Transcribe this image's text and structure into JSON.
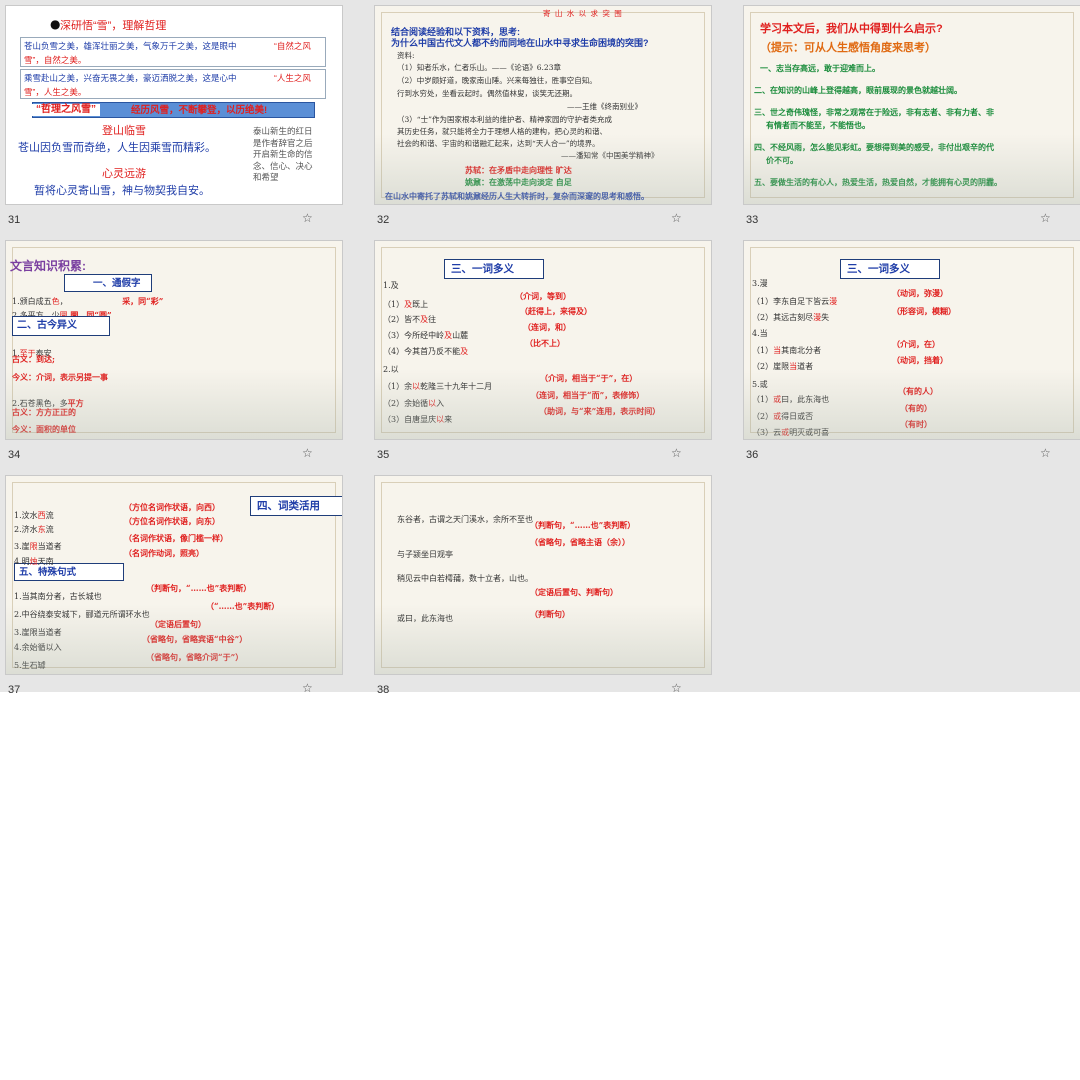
{
  "slides": {
    "s31": {
      "number": "31",
      "title": "深研悟“雪”，理解哲理",
      "box1_a": "苍山负雪之美，雄浑壮丽之美，气象万千之美，这是眼中",
      "box1_b": "“自然之风",
      "box1_c": "雪”，自然之美。",
      "box2_a": "乘雪赴山之美，兴奋无畏之美，豪迈洒脱之美，这是心中",
      "box2_b": "“人生之风",
      "box2_c": "雪”，人生之美。",
      "banner_left": "“哲理之风雪”",
      "banner_right": "经历风雪，不断攀登，以历绝美!",
      "heading1": "登山临雪",
      "line1": "苍山因负雪而奇绝，人生因乘雪而精彩。",
      "heading2": "心灵远游",
      "line2": "暂将心灵寄山雪，神与物契我自安。",
      "side_note": [
        "泰山新生的红日",
        "是作者辞官之后",
        "开启新生命的信",
        "念、信心、决心",
        "和希望"
      ]
    },
    "s32": {
      "number": "32",
      "top": "寄 山 水 以 求 突 围",
      "q1": "结合阅读经验和以下资料，思考:",
      "q2": "为什么中国古代文人都不约而同地在山水中寻求生命困境的突围?",
      "lines": [
        "资料:",
        "（1）知者乐水，仁者乐山。——《论语》6.23章",
        "（2）中岁颇好道，晚家南山陲。兴来每独往，胜事空自知。",
        "行到水穷处，坐看云起时。偶然值林叟，谈笑无还期。",
        "——王维《终南别业》",
        "（3）“士”作为国家根本利益的维护者、精神家园的守护者类充成",
        "其历史任务，就只能将全力于理想人格的建构，把心灵的和谐、",
        "社会的和谐、宇宙的和谐融汇起来，达到“天人合一”的境界。",
        "——潘知常《中国美学精神》"
      ],
      "r1": "苏轼：在矛盾中走向理性 旷达",
      "r2": "姚鼐：在激荡中走向淡定 自足",
      "bottom": "在山水中寄托了苏轼和姚鼐经历人生大转折时，复杂而深邃的思考和感悟。"
    },
    "s33": {
      "number": "33",
      "title": "学习本文后，我们从中得到什么启示?",
      "hint": "（提示：可从人生感悟角度来思考）",
      "items": [
        "一、志当存高远，敢于迎难而上。",
        "二、在知识的山峰上登得越高，眼前展现的景色就越壮阔。",
        "三、世之奇伟瑰怪，非常之观常在于险远，非有志者、非有力者、非",
        "有情者而不能至，不能悟也。",
        "四、不经风雨，怎么能见彩虹。要想得到美的感受，非付出艰辛的代",
        "价不可。",
        "五、要做生活的有心人，热爱生活，热爱自然，才能拥有心灵的阴霾。"
      ]
    },
    "s34": {
      "number": "34",
      "title": "文言知识积累:",
      "sec1": "一、通假字",
      "l1a": "1.颁白成五",
      "l1b": "色",
      "l1c": "，  ",
      "l1d": "采，同“彩”",
      "l2a": "2.多平方，少",
      "l2b": "圜",
      "l2c": "     圜，同“圆”",
      "sec2": "二、古今异义",
      "l3a": "1.",
      "l3b": "至于",
      "l3c": "泰安",
      "l4": "古义：到达;",
      "l5": "今义：介词，表示另提一事",
      "l6a": "2.石苍黑色，多",
      "l6b": "平方",
      "l7": "古义：方方正正的",
      "l8": "今义：面积的单位"
    },
    "s35": {
      "number": "35",
      "sec": "三、一词多义",
      "rows": [
        {
          "pre": "1.及",
          "hl": "",
          "post": "",
          "note": ""
        },
        {
          "pre": "（1）",
          "hl": "及",
          "post": "既上",
          "note": "（介词，等到）"
        },
        {
          "pre": "（2）皆不",
          "hl": "及",
          "post": "往",
          "note": "（赶得上，来得及）"
        },
        {
          "pre": "（3）今所经中岭",
          "hl": "及",
          "post": "山麓",
          "note": "（连词，和）"
        },
        {
          "pre": "（4）今其首乃反不能",
          "hl": "及",
          "post": "",
          "note": "（比不上）"
        },
        {
          "pre": "2.以",
          "hl": "",
          "post": "",
          "note": ""
        },
        {
          "pre": "（1）余",
          "hl": "以",
          "post": "乾隆三十九年十二月",
          "note": "（介词，相当于“于”，在）"
        },
        {
          "pre": "（2）余始循",
          "hl": "以",
          "post": "入",
          "note": "（连词，相当于“而”，表修饰）"
        },
        {
          "pre": "（3）自唐显庆",
          "hl": "以",
          "post": "来",
          "note": "（助词，与“来”连用，表示时间）"
        }
      ]
    },
    "s36": {
      "number": "36",
      "sec": "三、一词多义",
      "rows": [
        {
          "pre": "3.漫",
          "hl": "",
          "post": "",
          "note": ""
        },
        {
          "pre": "（1）李东自足下皆云",
          "hl": "漫",
          "post": "",
          "note": "（动词，弥漫）"
        },
        {
          "pre": "（2）其远古刻尽",
          "hl": "漫",
          "post": "失",
          "note": "（形容词，模糊）"
        },
        {
          "pre": "4.当",
          "hl": "",
          "post": "",
          "note": ""
        },
        {
          "pre": "（1）",
          "hl": "当",
          "post": "其南北分者",
          "note": "（介词，在）"
        },
        {
          "pre": "（2）崖限",
          "hl": "当",
          "post": "道者",
          "note": "（动词，挡着）"
        },
        {
          "pre": "5.或",
          "hl": "",
          "post": "",
          "note": ""
        },
        {
          "pre": "（1）",
          "hl": "或",
          "post": "曰，此东海也",
          "note": "（有的人）"
        },
        {
          "pre": "（2）",
          "hl": "或",
          "post": "得日或否",
          "note": "（有的）"
        },
        {
          "pre": "（3）云",
          "hl": "或",
          "post": "明灭或可喜",
          "note": "（有时）"
        }
      ]
    },
    "s37": {
      "number": "37",
      "sec4": "四、词类活用",
      "sec5": "五、特殊句式",
      "rows": [
        {
          "pre": "1.汶水",
          "hl": "西",
          "post": "流",
          "note": "（方位名词作状语，向西）"
        },
        {
          "pre": "2.济水",
          "hl": "东",
          "post": "流",
          "note": "（方位名词作状语，向东）"
        },
        {
          "pre": "3.崖",
          "hl": "限",
          "post": "当道者",
          "note": "（名词作状语，像门槛一样）"
        },
        {
          "pre": "4.明",
          "hl": "烛",
          "post": "天南",
          "note": "（名词作动词，照亮）"
        },
        {
          "pre": "1.当其南分者，古长城也",
          "hl": "",
          "post": "",
          "note": "（判断句，“……也”表判断）"
        },
        {
          "pre": "2.中谷绕泰安城下，郦道元所谓环水也",
          "hl": "",
          "post": "",
          "note": "（“……也”表判断）"
        },
        {
          "pre": "3.崖限当道者",
          "hl": "",
          "post": "",
          "note": "（定语后置句）"
        },
        {
          "pre": "4.余始循以入",
          "hl": "",
          "post": "",
          "note": "（省略句，省略宾语“中谷”）"
        },
        {
          "pre": "5.生石罅",
          "hl": "",
          "post": "",
          "note": "（省略句，省略介词“于”）"
        }
      ]
    },
    "s38": {
      "number": "38",
      "rows": [
        {
          "text": "东谷者，古谓之天门溪水，余所不至也",
          "note": "（判断句，“……也”表判断）"
        },
        {
          "text": "与子颍坐日观亭",
          "note": "（省略句，省略主语（余））"
        },
        {
          "text": "稍见云中白若樗蒱，数十立者，山也。",
          "note": "（定语后置句、判断句）"
        },
        {
          "text": "或曰，此东海也",
          "note": "（判断句）"
        }
      ]
    }
  },
  "star_icon": "star-outline-icon",
  "colors": {
    "red": "#e0201f",
    "blue": "#1f3da8",
    "green": "#1a8c3b",
    "orange": "#e06a12",
    "purple": "#7a3fa0",
    "banner": "#5b8fd6"
  }
}
